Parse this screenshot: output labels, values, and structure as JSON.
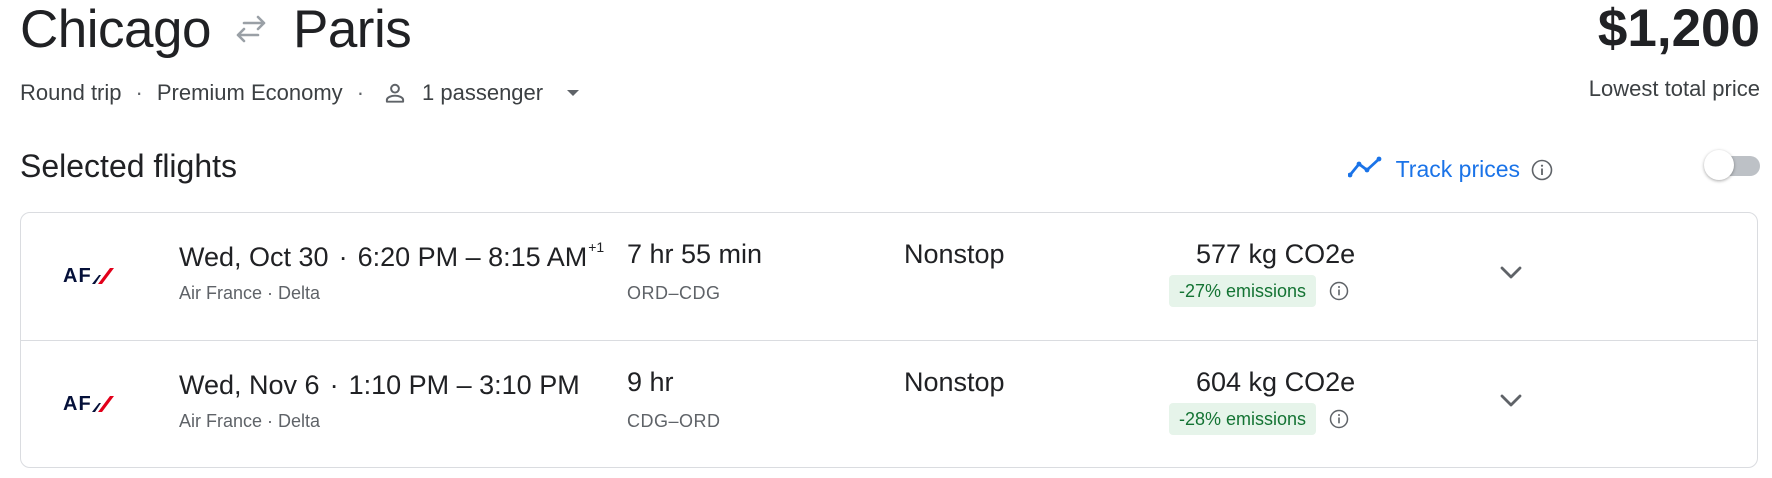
{
  "header": {
    "origin": "Chicago",
    "destination": "Paris",
    "price": "$1,200",
    "price_label": "Lowest total price"
  },
  "trip": {
    "type": "Round trip",
    "cabin": "Premium Economy",
    "passengers": "1 passenger"
  },
  "section": {
    "title": "Selected flights",
    "track_label": "Track prices",
    "track_enabled": false
  },
  "flights": [
    {
      "date": "Wed, Oct 30",
      "times": "6:20 PM – 8:15 AM",
      "day_offset": "+1",
      "airlines": "Air France · Delta",
      "airline_logo": "AF",
      "duration": "7 hr 55 min",
      "route": "ORD–CDG",
      "stops": "Nonstop",
      "emissions": "577 kg CO2e",
      "emissions_change": "-27% emissions"
    },
    {
      "date": "Wed, Nov 6",
      "times": "1:10 PM – 3:10 PM",
      "day_offset": "",
      "airlines": "Air France · Delta",
      "airline_logo": "AF",
      "duration": "9 hr",
      "route": "CDG–ORD",
      "stops": "Nonstop",
      "emissions": "604 kg CO2e",
      "emissions_change": "-28% emissions"
    }
  ],
  "colors": {
    "accent": "#1a73e8",
    "emissions_bg": "#e6f4ea",
    "emissions_text": "#137333",
    "logo_red": "#e2001a",
    "logo_navy": "#051039"
  },
  "icons": {
    "swap": "swap-arrows-icon",
    "passenger": "person-icon",
    "dropdown": "caret-down-icon",
    "track": "trend-line-icon",
    "info": "info-icon",
    "expand": "chevron-down-icon"
  }
}
